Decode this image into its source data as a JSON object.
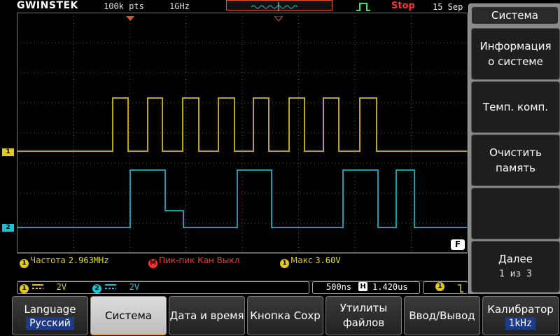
{
  "brand": "GWINSTEK",
  "top": {
    "record_length": "100k pts",
    "sample_rate": "1GHz",
    "run_status": "Stop",
    "date": "15 Sep"
  },
  "channels": {
    "ch1": {
      "marker": "1",
      "color": "#e0c820"
    },
    "ch2": {
      "marker": "2",
      "color": "#20c0d0"
    }
  },
  "filter_badge": "F",
  "measurements": [
    {
      "icon": "1",
      "label": "Частота",
      "value": "2.963MHz",
      "color": "#e0c820"
    },
    {
      "icon": "M",
      "label": "Пик-пик Кан Выкл",
      "value": "",
      "color": "#ff3030"
    },
    {
      "icon": "1",
      "label": "Макс",
      "value": "3.60V",
      "color": "#e0c820"
    }
  ],
  "status": {
    "ch1_num": "1",
    "ch1_scale": "2V",
    "ch2_num": "2",
    "ch2_scale": "2V",
    "timebase": "500ns",
    "horiz_icon": "H",
    "horiz_pos": "1.420us",
    "trig_source": "1"
  },
  "side_menu": {
    "title": "Система",
    "buttons": [
      {
        "label": "Информация о системе"
      },
      {
        "label": "Темп. комп."
      },
      {
        "label": "Очистить память"
      },
      {
        "label": ""
      },
      {
        "label": "Далее",
        "sub": "1 из 3"
      }
    ]
  },
  "soft_keys": [
    {
      "label": "Language",
      "value": "Русский"
    },
    {
      "label": "Система"
    },
    {
      "label": "Дата и время"
    },
    {
      "label": "Кнопка Сохр"
    },
    {
      "label": "Утилиты файлов"
    },
    {
      "label": "Ввод/Вывод"
    },
    {
      "label": "Калибратор",
      "value": "1kHz"
    }
  ],
  "colors": {
    "ch1": "#e0c820",
    "ch2": "#20c0d0",
    "accent": "#e08020",
    "stop": "#ff3030"
  }
}
